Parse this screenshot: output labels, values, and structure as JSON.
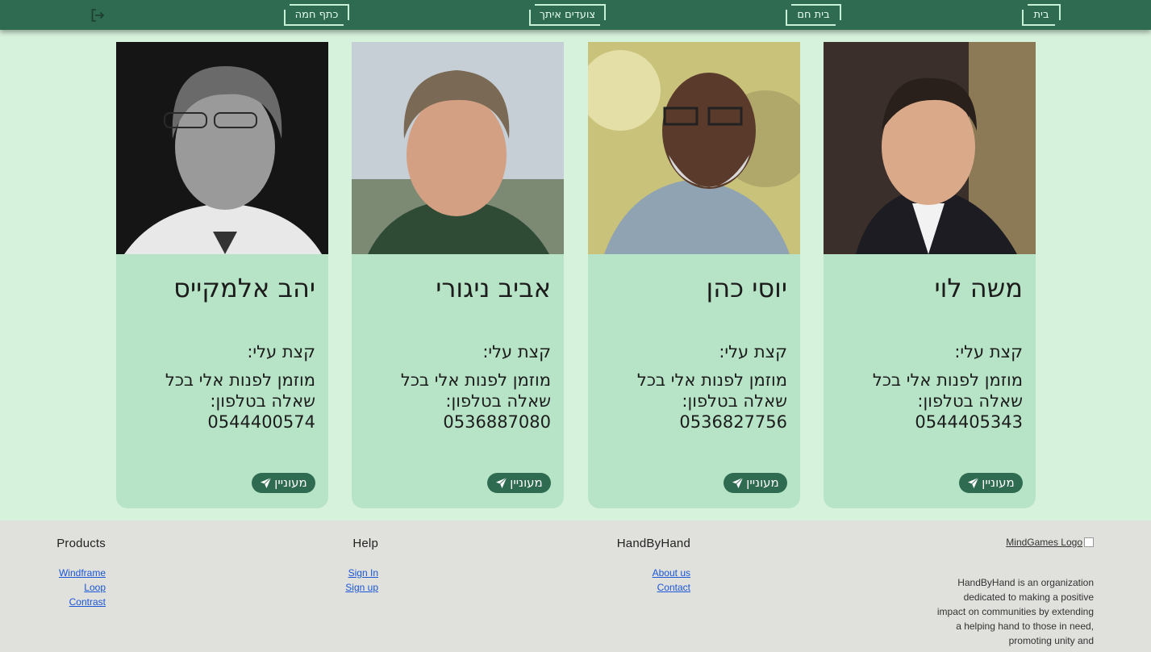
{
  "nav": {
    "home": "בית",
    "warm_home": "בית חם",
    "walking_with_you": "צועדים איתך",
    "warm_shoulder": "כתף חמה"
  },
  "cards": [
    {
      "name": "משה לוי",
      "about_label": "קצת עלי:",
      "about_text": "מוזמן לפנות אלי בכל שאלה בטלפון:",
      "phone": "0544405343",
      "button": "מעוניין"
    },
    {
      "name": "יוסי כהן",
      "about_label": "קצת עלי:",
      "about_text": "מוזמן לפנות אלי בכל שאלה בטלפון:",
      "phone": "0536827756",
      "button": "מעוניין"
    },
    {
      "name": "אביב ניגורי",
      "about_label": "קצת עלי:",
      "about_text": "מוזמן לפנות אלי בכל שאלה בטלפון:",
      "phone": "0536887080",
      "button": "מעוניין"
    },
    {
      "name": "יהב אלמקייס",
      "about_label": "קצת עלי:",
      "about_text": "מוזמן לפנות אלי בכל שאלה בטלפון:",
      "phone": "0544400574",
      "button": "מעוניין"
    }
  ],
  "footer": {
    "products": {
      "title": "Products",
      "links": [
        "Windframe",
        "Loop",
        "Contrast"
      ]
    },
    "help": {
      "title": "Help",
      "links": [
        "Sign In",
        "Sign up"
      ]
    },
    "handbyhand": {
      "title": "HandByHand",
      "links": [
        "About us",
        "Contact"
      ]
    },
    "logo_alt": "MindGames Logo",
    "description": "HandByHand is an organization dedicated to making a positive impact on communities by extending a helping hand to those in need, promoting unity and"
  },
  "colors": {
    "nav_bg": "#2e6b51",
    "page_bg": "#d7f2dc",
    "card_bg": "#b7e4c7",
    "button_bg": "#2e6b51",
    "footer_bg": "#e0e0dd",
    "link": "#1a56d6"
  },
  "icons": {
    "logout": "logout-icon",
    "send": "send-icon"
  }
}
